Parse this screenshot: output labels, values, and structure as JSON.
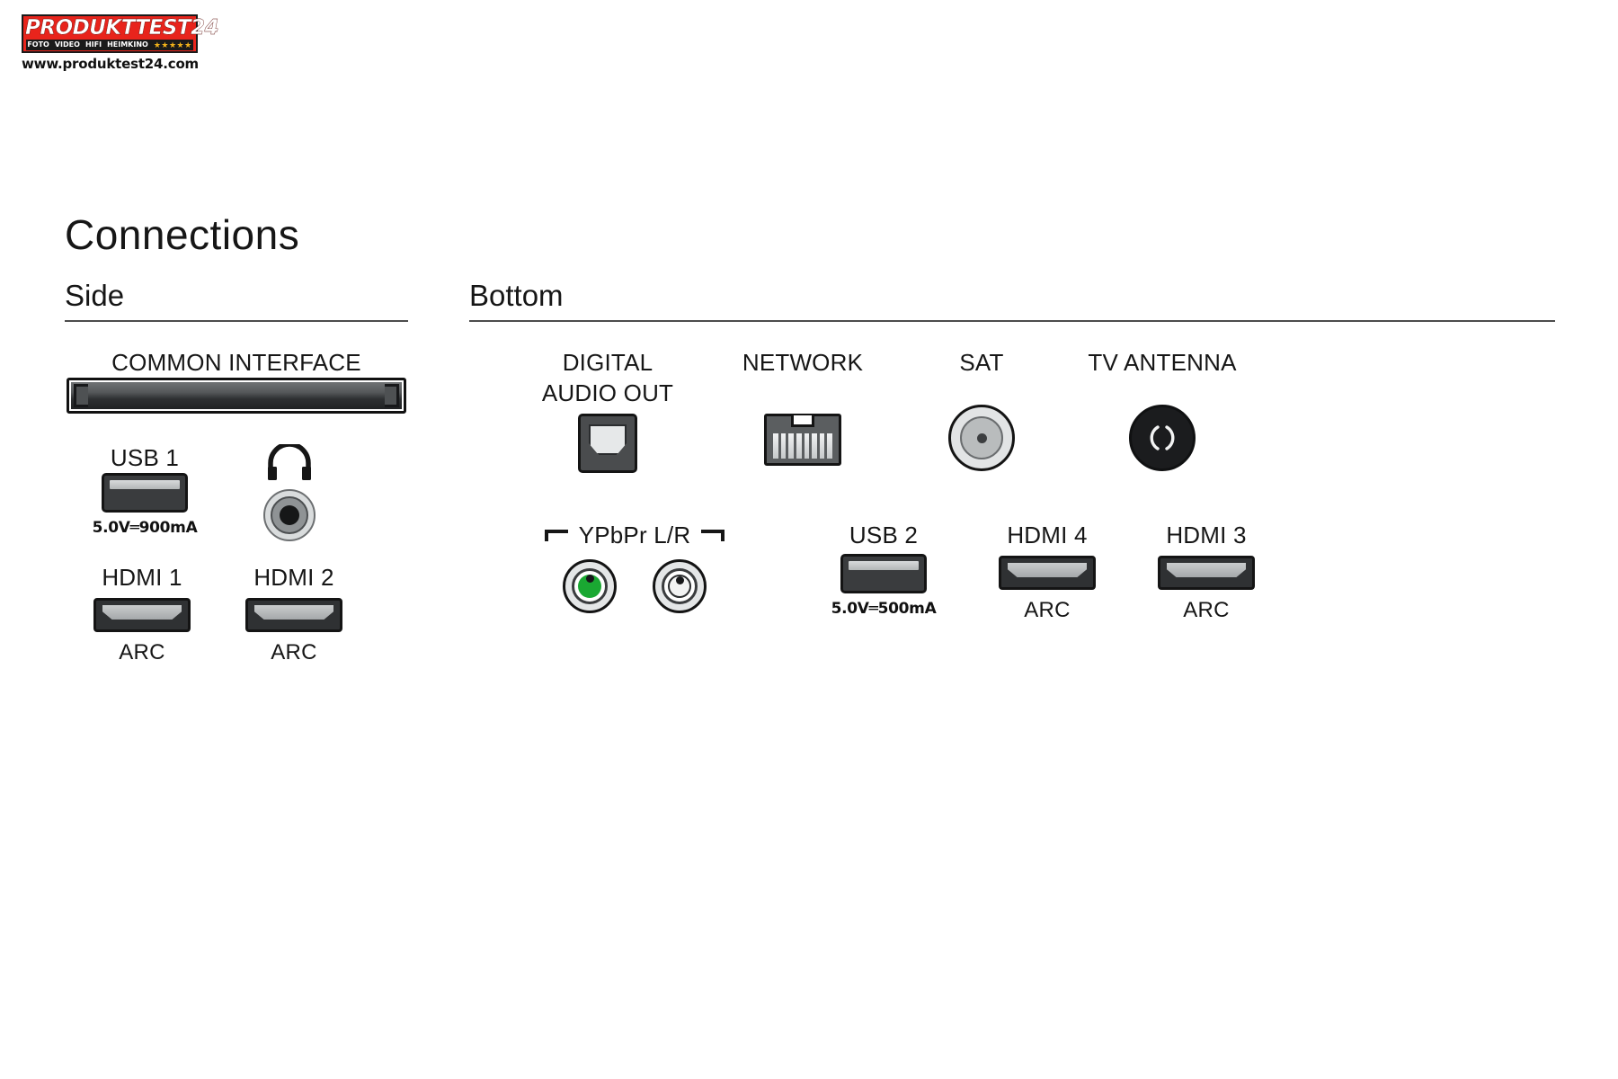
{
  "watermark": {
    "brand": "PRODUKTTEST24",
    "categories": [
      "FOTO",
      "VIDEO",
      "HIFI",
      "HEIMKINO"
    ],
    "stars": "★★★★★",
    "url": "www.produktest24.com",
    "brand_bg": "#e8241c",
    "star_color": "#f2b21a"
  },
  "page": {
    "title": "Connections"
  },
  "sections": {
    "side": {
      "heading": "Side"
    },
    "bottom": {
      "heading": "Bottom"
    }
  },
  "side_ports": {
    "common_interface": {
      "label": "COMMON INTERFACE",
      "icon": "ci-slot-icon"
    },
    "usb1": {
      "label": "USB 1",
      "rating": "5.0V═900mA",
      "icon": "usb-port-icon"
    },
    "headphone": {
      "label": "",
      "icon": "headphone-icon"
    },
    "hdmi1": {
      "label": "HDMI 1",
      "arc": "ARC",
      "icon": "hdmi-port-icon"
    },
    "hdmi2": {
      "label": "HDMI 2",
      "arc": "ARC",
      "icon": "hdmi-port-icon"
    }
  },
  "bottom_ports": {
    "digital_audio_out": {
      "label_line1": "DIGITAL",
      "label_line2": "AUDIO OUT",
      "icon": "optical-toslink-icon"
    },
    "network": {
      "label": "NETWORK",
      "icon": "rj45-ethernet-icon"
    },
    "sat": {
      "label": "SAT",
      "icon": "coax-f-connector-icon"
    },
    "tv_antenna": {
      "label": "TV ANTENNA",
      "icon": "iec-antenna-icon"
    },
    "ypbpr": {
      "label": "YPbPr L/R",
      "icon": "rca-jacks-icon",
      "green_color": "#1aa832"
    },
    "usb2": {
      "label": "USB 2",
      "rating": "5.0V═500mA",
      "icon": "usb-port-icon"
    },
    "hdmi4": {
      "label": "HDMI 4",
      "arc": "ARC",
      "icon": "hdmi-port-icon"
    },
    "hdmi3": {
      "label": "HDMI 3",
      "arc": "ARC",
      "icon": "hdmi-port-icon"
    }
  }
}
